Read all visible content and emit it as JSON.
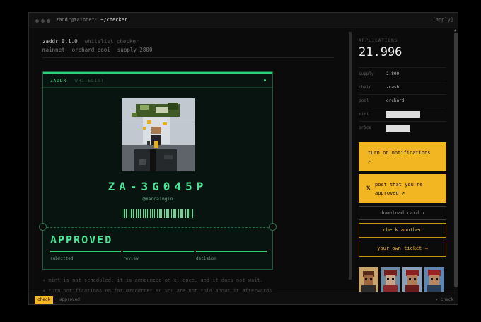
{
  "window": {
    "title_user": "zaddr@mainnet:",
    "title_path": "~/checker",
    "apply_label": "[apply]"
  },
  "header": {
    "app_name": "zaddr 0.1.0",
    "app_desc": "whitelist checker",
    "network": "mainnet",
    "pool": "orchard pool",
    "supply": "supply 2800"
  },
  "ticket": {
    "brand": "ZADDR",
    "tag": "WHITELIST",
    "id": "ZA-3G045P",
    "handle": "@maccaingio",
    "status": "APPROVED",
    "steps": [
      {
        "label": "submitted"
      },
      {
        "label": "review"
      },
      {
        "label": "decision"
      }
    ]
  },
  "notes": [
    "∗ mint is not scheduled. it is announced on x, once, and it does not wait.",
    "∗ turn notifications on for @zaddrnet so you are not told about it afterwards."
  ],
  "sidebar": {
    "applications_label": "APPLICATIONS",
    "applications_count": "21.996",
    "stats": [
      {
        "key": "supply",
        "value": "2,800"
      },
      {
        "key": "chain",
        "value": "zcash"
      },
      {
        "key": "pool",
        "value": "orchard"
      },
      {
        "key": "mint",
        "value": ""
      },
      {
        "key": "price",
        "value": ""
      }
    ],
    "notify_line1": "turn on notifications",
    "notify_line2": "↗",
    "post_icon": "𝕏",
    "post_line1": "post that you're",
    "post_line2": "approved ↗",
    "download_label": "download card ↓",
    "check_another_label": "check another",
    "own_ticket_label": "your own ticket →"
  },
  "statusbar": {
    "check_tab": "check",
    "approved_label": "approved",
    "check_right": "✔ check"
  },
  "colors": {
    "accent_green": "#4de598",
    "accent_yellow": "#f3b623",
    "background": "#0b0b0b"
  }
}
